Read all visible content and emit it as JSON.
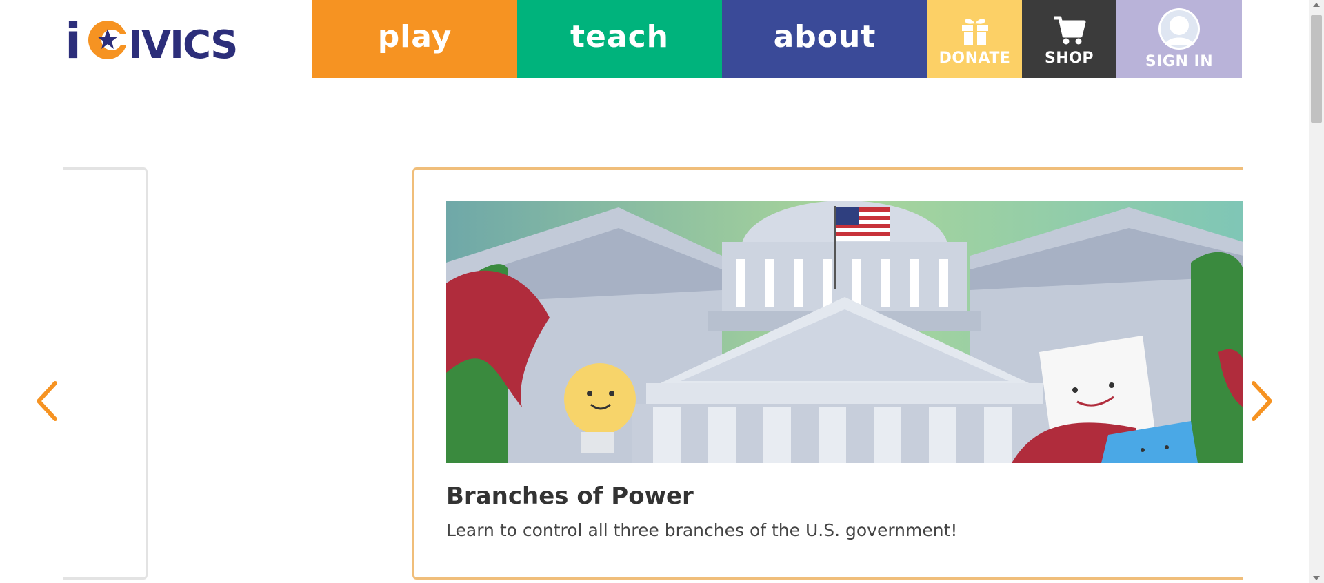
{
  "logo": {
    "text": "iCivics"
  },
  "nav": {
    "play": "play",
    "teach": "teach",
    "about": "about",
    "donate": "DONATE",
    "shop": "SHOP",
    "sign_in": "SIGN IN"
  },
  "icons": {
    "donate": "gift-icon",
    "shop": "cart-icon",
    "sign_in": "user-avatar-icon",
    "prev": "chevron-left-icon",
    "next": "chevron-right-icon"
  },
  "colors": {
    "play": "#f69322",
    "teach": "#00b37c",
    "about": "#3a4a98",
    "donate": "#fcd066",
    "shop": "#3b3b3b",
    "sign_in": "#b9b3d9",
    "logo": "#2c2e7a",
    "logo_accent": "#f69322",
    "card_border": "#f0be7a"
  },
  "carousel": {
    "card": {
      "title": "Branches of Power",
      "description": "Learn to control all three branches of the U.S. government!"
    }
  }
}
